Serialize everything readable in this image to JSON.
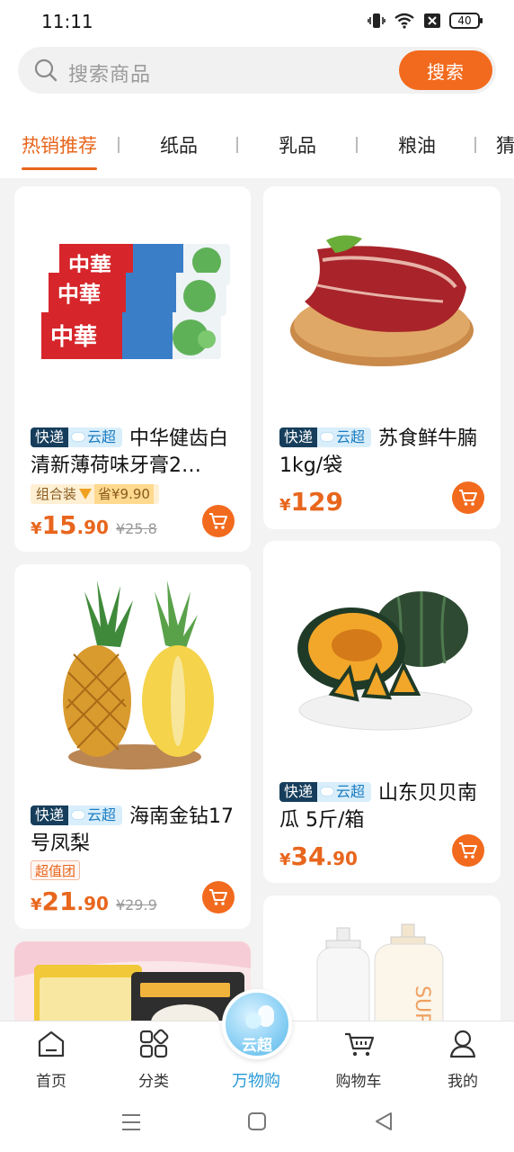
{
  "status_bar": {
    "time": "11:11",
    "battery": "40"
  },
  "search": {
    "placeholder": "搜索商品",
    "button_label": "搜索"
  },
  "tabs": [
    {
      "label": "热销推荐",
      "active": true
    },
    {
      "label": "纸品"
    },
    {
      "label": "乳品"
    },
    {
      "label": "粮油"
    },
    {
      "label": "猜"
    }
  ],
  "tags": {
    "express": "快递",
    "cloud": "云超"
  },
  "products": [
    {
      "title": "中华健齿白清新薄荷味牙膏2…",
      "promo_label": "组合装",
      "promo_save": "省¥9.90",
      "price_currency": "¥",
      "price_int": "15",
      "price_dec": ".90",
      "old_price": "¥25.8"
    },
    {
      "title": "苏食鲜牛腩 1kg/袋",
      "price_currency": "¥",
      "price_int": "129",
      "price_dec": ""
    },
    {
      "title": "海南金钻17号凤梨",
      "promo_value": "超值团",
      "price_currency": "¥",
      "price_int": "21",
      "price_dec": ".90",
      "old_price": "¥29.9"
    },
    {
      "title": "山东贝贝南瓜 5斤/箱",
      "price_currency": "¥",
      "price_int": "34",
      "price_dec": ".90"
    }
  ],
  "bottom_nav": {
    "home": "首页",
    "category": "分类",
    "center": "万物购",
    "center_badge": "云超",
    "cart": "购物车",
    "mine": "我的"
  },
  "colors": {
    "accent": "#f26a1d",
    "tag_dark": "#163e5c",
    "tag_light": "#d9eefb",
    "nav_active": "#2a9ad8"
  }
}
